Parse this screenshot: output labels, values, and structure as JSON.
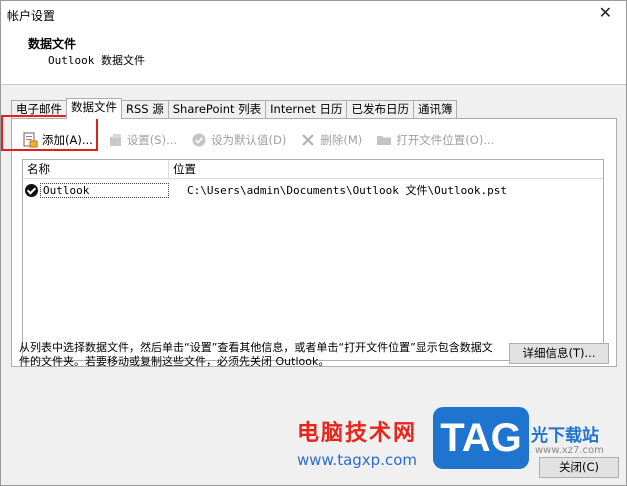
{
  "window": {
    "title": "帐户设置",
    "close_glyph": "✕"
  },
  "header": {
    "title": "数据文件",
    "subtitle": "Outlook 数据文件"
  },
  "tabs": [
    {
      "label": "电子邮件",
      "active": false
    },
    {
      "label": "数据文件",
      "active": true
    },
    {
      "label": "RSS 源",
      "active": false
    },
    {
      "label": "SharePoint 列表",
      "active": false
    },
    {
      "label": "Internet 日历",
      "active": false
    },
    {
      "label": "已发布日历",
      "active": false
    },
    {
      "label": "通讯簿",
      "active": false
    }
  ],
  "toolbar": {
    "add": "添加(A)...",
    "settings": "设置(S)...",
    "set_default": "设为默认值(D)",
    "delete": "删除(M)",
    "open_location": "打开文件位置(O)..."
  },
  "list": {
    "columns": {
      "name": "名称",
      "location": "位置"
    },
    "rows": [
      {
        "name": "Outlook",
        "location": "C:\\Users\\admin\\Documents\\Outlook 文件\\Outlook.pst"
      }
    ]
  },
  "hint": "从列表中选择数据文件，然后单击“设置”查看其他信息，或者单击“打开文件位置”显示包含数据文件的文件夹。若要移动或复制这些文件，必须先关闭 Outlook。",
  "buttons": {
    "details": "详细信息(T)...",
    "close": "关闭(C)"
  },
  "watermark": {
    "text": "电脑技术网",
    "url": "www.tagxp.com",
    "logo": "TAG",
    "logo_sub": "光下载站",
    "logo_sub2": "www.xz7.com"
  },
  "colors": {
    "highlight": "#e0231a",
    "panel_bg": "#f0f0f0",
    "accent_blue": "#1f74cf"
  }
}
